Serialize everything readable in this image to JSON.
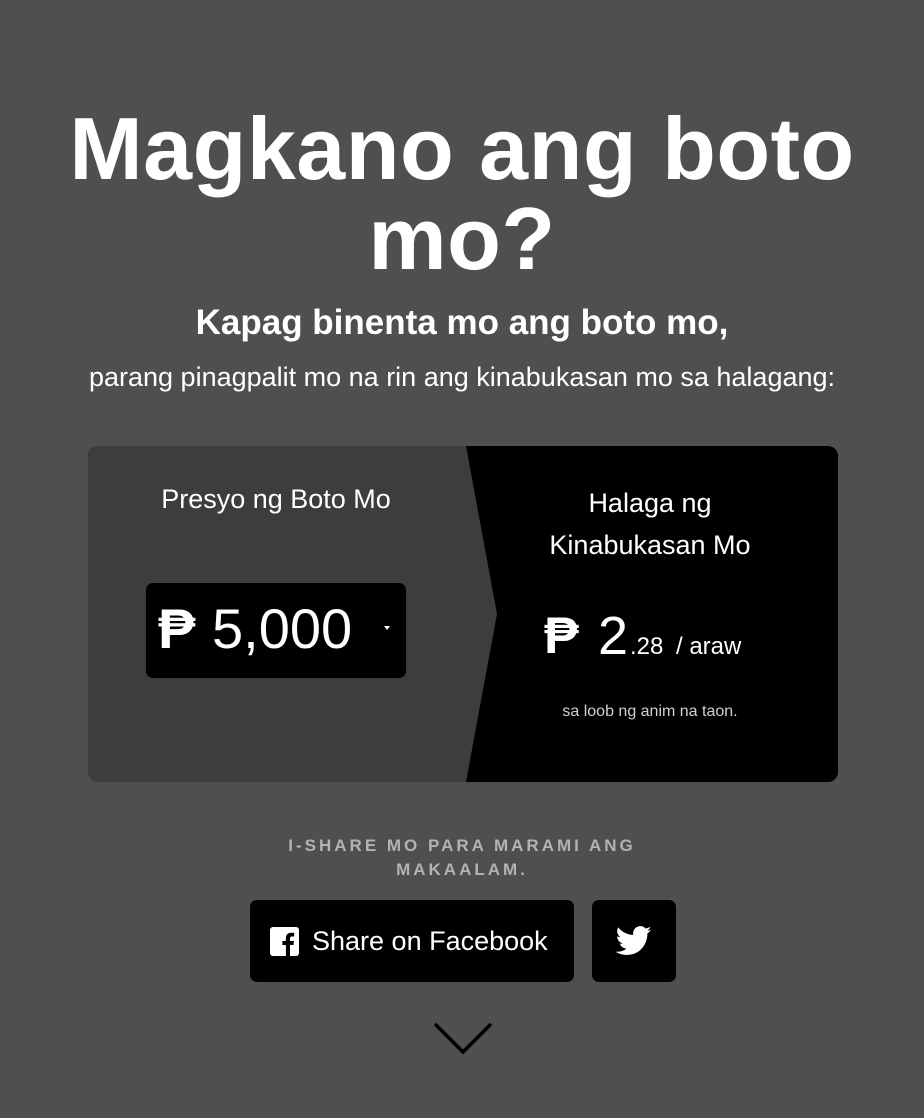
{
  "header": {
    "title": "Magkano ang boto mo?",
    "subtitle": "Kapag binenta mo ang boto mo,",
    "subtext": "parang pinagpalit mo na rin ang kinabukasan mo sa halagang:"
  },
  "calculator": {
    "left": {
      "label": "Presyo ng Boto Mo",
      "currency_symbol": "₱",
      "selected_amount": "5,000"
    },
    "right": {
      "label_line1": "Halaga ng",
      "label_line2": "Kinabukasan Mo",
      "currency_symbol": "₱",
      "value_whole": "2",
      "value_cents": ".28",
      "per_unit": "/ araw",
      "note": "sa loob ng anim na taon."
    }
  },
  "share": {
    "heading": "I-SHARE MO PARA MARAMI ANG MAKAALAM.",
    "facebook_label": "Share on Facebook"
  },
  "colors": {
    "background": "#4f4f4f",
    "left_panel": "#3d3d3d",
    "right_panel": "#000000",
    "text": "#ffffff",
    "muted_text": "#b3b3b3"
  }
}
